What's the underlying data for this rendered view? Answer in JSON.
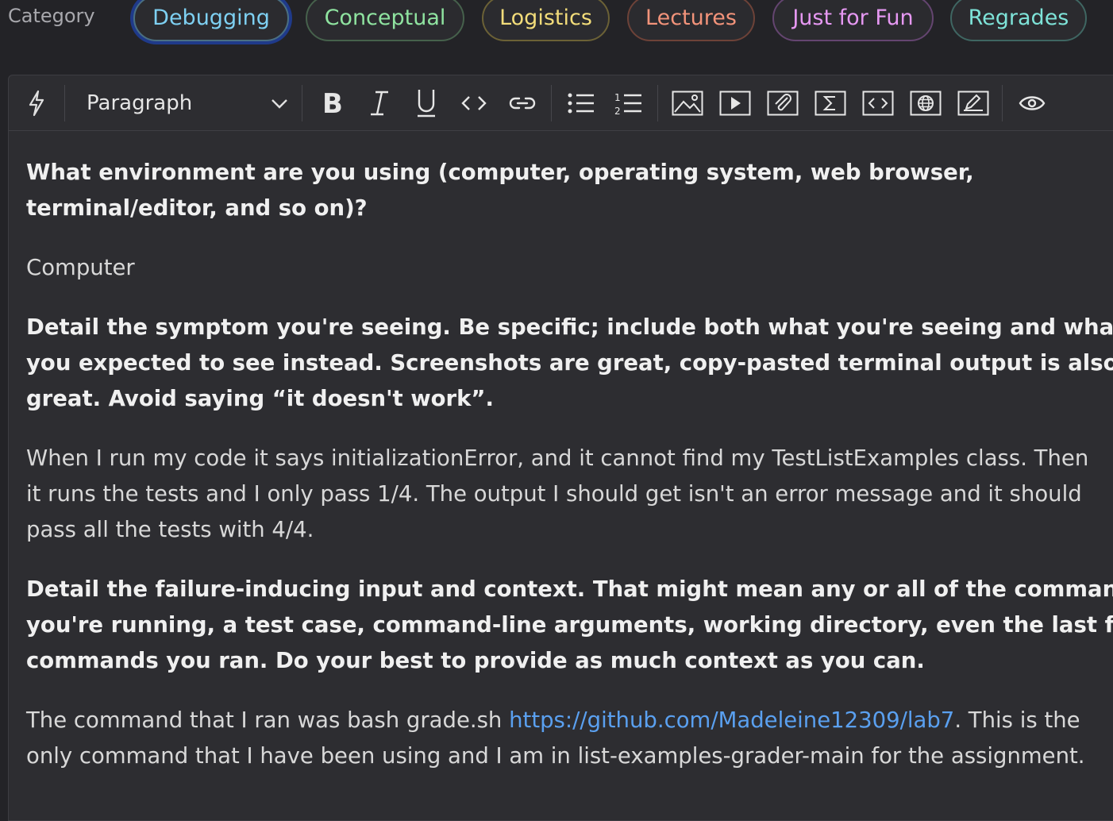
{
  "category": {
    "label": "Category",
    "options": [
      {
        "label": "Debugging",
        "color": "#7ed0f2",
        "border": "#4a6f82",
        "selected": true
      },
      {
        "label": "Conceptual",
        "color": "#8fe3a0",
        "border": "#46614c"
      },
      {
        "label": "Logistics",
        "color": "#f2dc7a",
        "border": "#6b6136"
      },
      {
        "label": "Lectures",
        "color": "#f2937a",
        "border": "#6d4238"
      },
      {
        "label": "Just for Fun",
        "color": "#e698f2",
        "border": "#644570"
      },
      {
        "label": "Regrades",
        "color": "#7ee3d8",
        "border": "#3f6662"
      }
    ]
  },
  "toolbar": {
    "paragraph_style": "Paragraph",
    "icons": [
      "lightning-icon",
      "bold-icon",
      "italic-icon",
      "underline-icon",
      "code-icon",
      "link-icon",
      "bullet-list-icon",
      "numbered-list-icon",
      "image-icon",
      "video-icon",
      "attachment-icon",
      "math-icon",
      "code-block-icon",
      "web-embed-icon",
      "drawing-icon",
      "preview-icon"
    ]
  },
  "content": {
    "q1": "What environment are you using (computer, operating system, web browser,",
    "q1b": "terminal/editor, and so on)?",
    "a1": "Computer",
    "q2a": "Detail the symptom you're seeing. Be specific; include both what you're seeing and what",
    "q2b": "you expected to see instead. Screenshots are great, copy-pasted terminal output is also",
    "q2c": "great. Avoid saying “it doesn't work”.",
    "a2a": "When I run my code it says initializationError, and it cannot find my TestListExamples class. Then",
    "a2b": "it runs the tests and I only pass 1/4. The output I should get isn't an error message and it should",
    "a2c": "pass all the tests with 4/4.",
    "q3a": "Detail the failure-inducing input and context. That might mean any or all of the command",
    "q3b": "you're running, a test case, command-line arguments, working directory, even the last few",
    "q3c": "commands you ran. Do your best to provide as much context as you can.",
    "a3_pre": "The command that I ran was bash grade.sh ",
    "a3_link": "https://github.com/Madeleine12309/lab7",
    "a3_post": ". This is the",
    "a3b": "only command that I have been using and I am in list-examples-grader-main for the assignment."
  }
}
